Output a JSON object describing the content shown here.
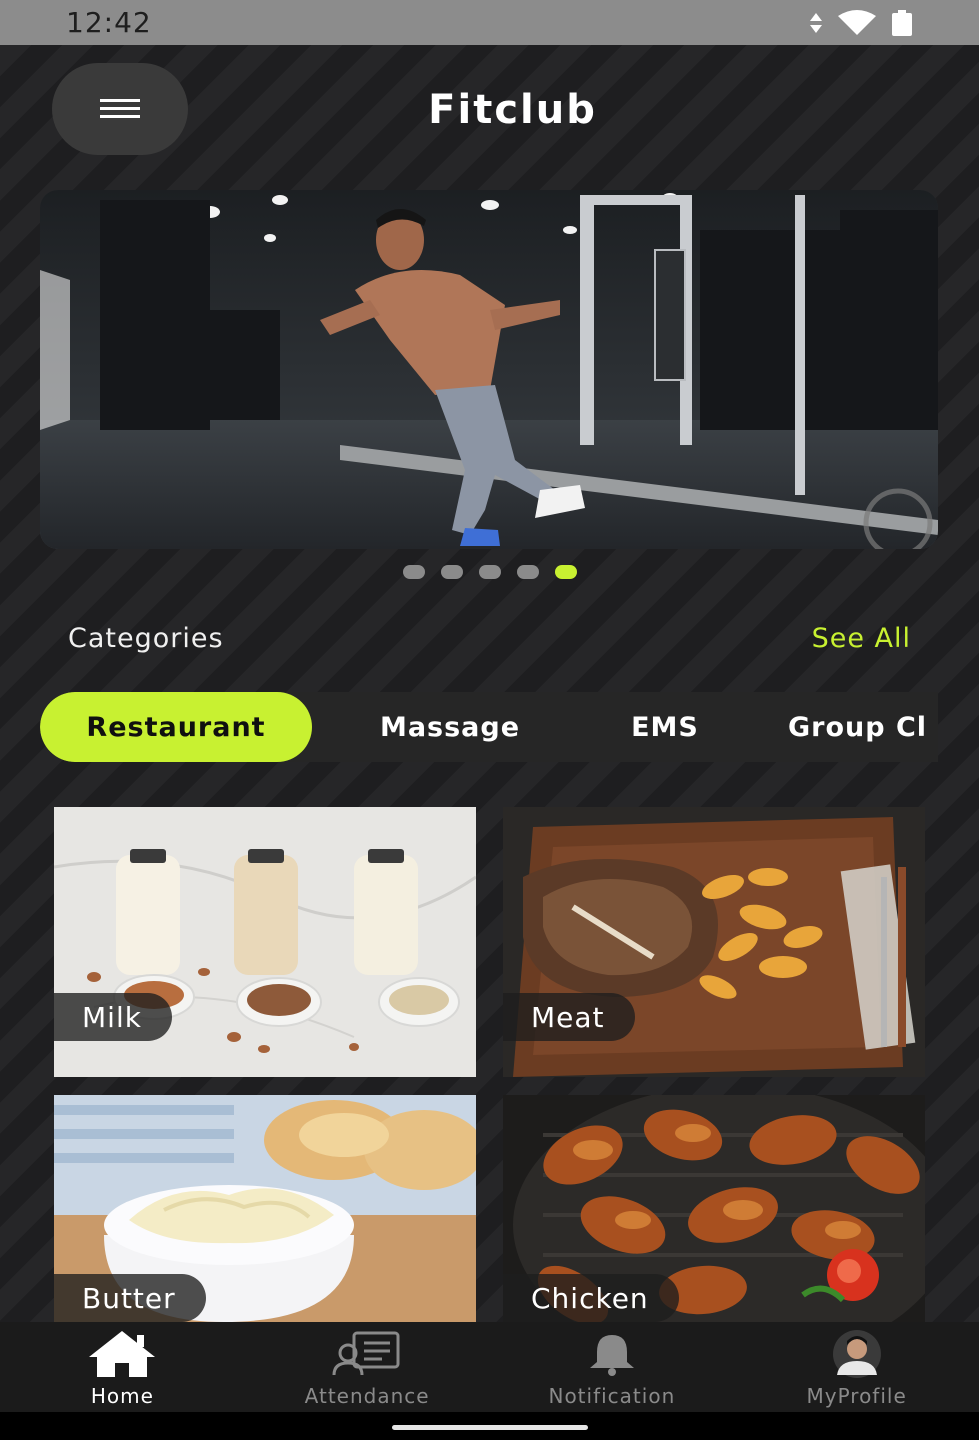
{
  "status_bar": {
    "time": "12:42"
  },
  "header": {
    "title": "Fitclub"
  },
  "carousel": {
    "slide_count": 5,
    "active_index": 4
  },
  "categories": {
    "title": "Categories",
    "see_all": "See All"
  },
  "tabs": [
    {
      "label": "Restaurant",
      "active": true
    },
    {
      "label": "Massage",
      "active": false
    },
    {
      "label": "EMS",
      "active": false
    },
    {
      "label": "Group Cl",
      "active": false
    }
  ],
  "items": [
    {
      "label": "Milk"
    },
    {
      "label": "Meat"
    },
    {
      "label": "Butter"
    },
    {
      "label": "Chicken"
    }
  ],
  "bottom_nav": [
    {
      "label": "Home",
      "icon": "home-icon",
      "active": true
    },
    {
      "label": "Attendance",
      "icon": "attendance-icon",
      "active": false
    },
    {
      "label": "Notification",
      "icon": "bell-icon",
      "active": false
    },
    {
      "label": "MyProfile",
      "icon": "avatar",
      "active": false
    }
  ],
  "colors": {
    "accent": "#c8f131",
    "background": "#1e1e20",
    "nav_background": "#1b1b1b"
  }
}
